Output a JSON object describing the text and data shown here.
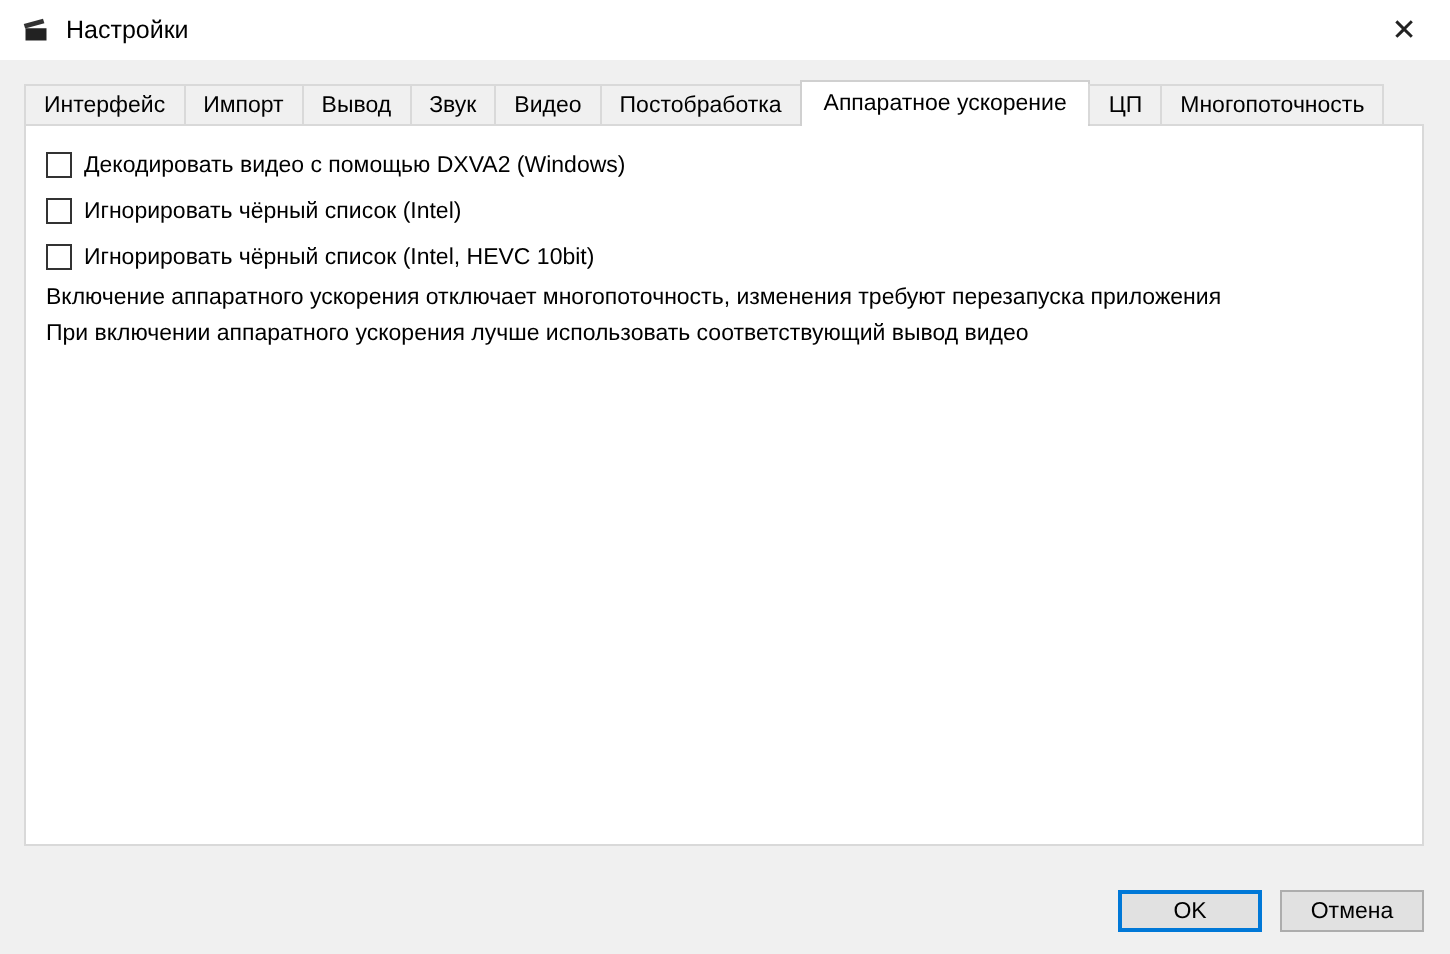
{
  "window": {
    "title": "Настройки",
    "close": "✕"
  },
  "tabs": [
    {
      "label": "Интерфейс",
      "selected": false
    },
    {
      "label": "Импорт",
      "selected": false
    },
    {
      "label": "Вывод",
      "selected": false
    },
    {
      "label": "Звук",
      "selected": false
    },
    {
      "label": "Видео",
      "selected": false
    },
    {
      "label": "Постобработка",
      "selected": false
    },
    {
      "label": "Аппаратное ускорение",
      "selected": true
    },
    {
      "label": "ЦП",
      "selected": false
    },
    {
      "label": "Многопоточность",
      "selected": false
    }
  ],
  "options": [
    {
      "label": "Декодировать видео с помощью DXVA2 (Windows)",
      "checked": false
    },
    {
      "label": "Игнорировать чёрный список (Intel)",
      "checked": false
    },
    {
      "label": "Игнорировать чёрный список (Intel, HEVC 10bit)",
      "checked": false
    }
  ],
  "notes": [
    "Включение аппаратного ускорения отключает многопоточность, изменения требуют перезапуска приложения",
    "При включении аппаратного ускорения лучше использовать соответствующий вывод видео"
  ],
  "buttons": [
    {
      "label": "OK",
      "default": true
    },
    {
      "label": "Отмена",
      "default": false
    }
  ]
}
